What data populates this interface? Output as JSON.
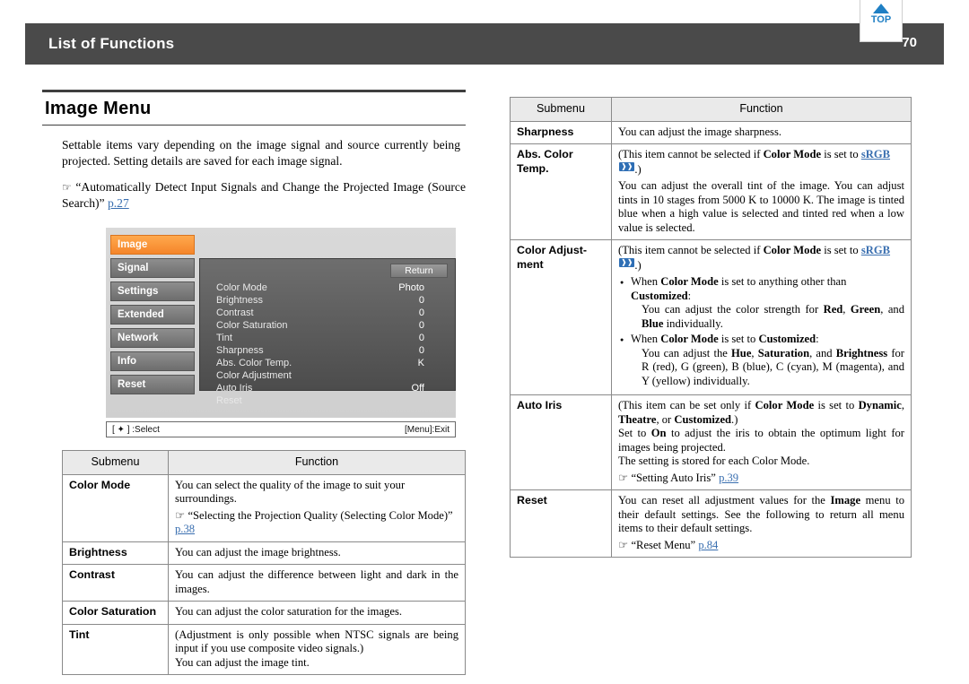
{
  "header": {
    "title": "List of Functions",
    "page_number": "70",
    "top_button_label": "TOP"
  },
  "section": {
    "title": "Image Menu",
    "intro": "Settable items vary depending on the image signal and source currently being projected. Setting details are saved for each image signal.",
    "reference_text": "“Automatically Detect Input Signals and Change the Projected Image (Source Search)”",
    "reference_link": "p.27"
  },
  "osd": {
    "menu_items": [
      "Image",
      "Signal",
      "Settings",
      "Extended",
      "Network",
      "Info",
      "Reset"
    ],
    "active_item": "Image",
    "return_label": "Return",
    "rows": [
      {
        "label": "Color Mode",
        "value": "Photo"
      },
      {
        "label": "Brightness",
        "value": "0"
      },
      {
        "label": "Contrast",
        "value": "0"
      },
      {
        "label": "Color Saturation",
        "value": "0"
      },
      {
        "label": "Tint",
        "value": "0"
      },
      {
        "label": "Sharpness",
        "value": "0"
      },
      {
        "label": "Abs. Color Temp.",
        "value": "K"
      },
      {
        "label": "Color Adjustment",
        "value": ""
      },
      {
        "label": "Auto Iris",
        "value": "Off"
      },
      {
        "label": "Reset",
        "value": ""
      }
    ],
    "footer_left": "[ ✦ ] :Select",
    "footer_right": "[Menu]:Exit"
  },
  "left_table": {
    "headers": [
      "Submenu",
      "Function"
    ],
    "rows": [
      {
        "submenu": "Color Mode",
        "function_line1": "You can select the quality of the image to suit your surroundings.",
        "reference_text": "“Selecting the Projection Quality (Selecting Color Mode)”",
        "reference_link": "p.38"
      },
      {
        "submenu": "Brightness",
        "function_line1": "You can adjust the image brightness."
      },
      {
        "submenu": "Contrast",
        "function_line1": "You can adjust the difference between light and dark in the images."
      },
      {
        "submenu": "Color Saturation",
        "function_line1": "You can adjust the color saturation for the images."
      },
      {
        "submenu": "Tint",
        "function_line1": "(Adjustment is only possible when NTSC signals are being input if you use composite video signals.)",
        "function_line2": "You can adjust the image tint."
      }
    ]
  },
  "right_table": {
    "headers": [
      "Submenu",
      "Function"
    ],
    "rows": [
      {
        "submenu": "Sharpness",
        "line1": "You can adjust the image sharpness."
      },
      {
        "submenu": "Abs. Color Temp.",
        "line1_pre": "(This item cannot be selected if ",
        "line1_bold": "Color Mode",
        "line1_mid": " is set to ",
        "line1_link": "sRGB",
        "line1_post": ".)",
        "line2": "You can adjust the overall tint of the image. You can adjust tints in 10 stages from 5000 K to 10000 K. The image is tinted blue when a high value is selected and tinted red when a low value is selected."
      },
      {
        "submenu": "Color Adjust-ment",
        "line1_pre": "(This item cannot be selected if ",
        "line1_bold": "Color Mode",
        "line1_mid": " is set to ",
        "line1_link": "sRGB",
        "line1_post": ".)",
        "bullet1": "When Color Mode is set to anything other than Customized:",
        "bullet1_detail": "You can adjust the color strength for Red, Green, and Blue individually.",
        "bullet2": "When Color Mode is set to Customized:",
        "bullet2_detail": "You can adjust the Hue, Saturation, and Brightness for R (red), G (green), B (blue), C (cyan), M (magenta), and Y (yellow) individually."
      },
      {
        "submenu": "Auto Iris",
        "line1": "(This item can be set only if Color Mode is set to Dynamic, Theatre, or Customized.)",
        "line2": "Set to On to adjust the iris to obtain the optimum light for images being projected.",
        "line3": "The setting is stored for each Color Mode.",
        "reference_text": "“Setting Auto Iris”",
        "reference_link": "p.39"
      },
      {
        "submenu": "Reset",
        "line1": "You can reset all adjustment values for the Image menu to their default settings. See the following to return all menu items to their default settings.",
        "reference_text": "“Reset Menu”",
        "reference_link": "p.84"
      }
    ]
  }
}
